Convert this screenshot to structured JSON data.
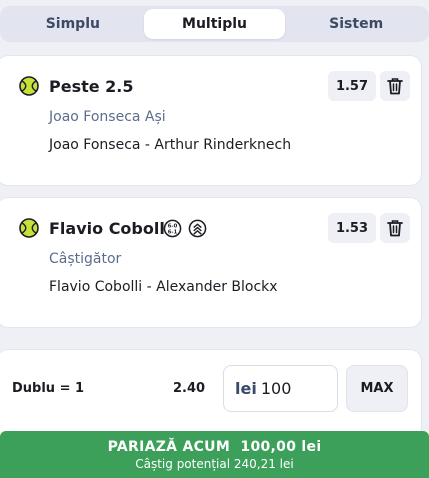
{
  "tabs": {
    "simplu": "Simplu",
    "multiplu": "Multiplu",
    "sistem": "Sistem",
    "active": "multiplu"
  },
  "selections": [
    {
      "title": "Peste 2.5",
      "market": "Joao Fonseca Ași",
      "event": "Joao Fonseca - Arthur Rinderknech",
      "odds": "1.57",
      "icon": "tennis-ball-icon"
    },
    {
      "title": "Flavio Cobolli",
      "market": "Câștigător",
      "event": "Flavio Cobolli - Alexander Blockx",
      "odds": "1.53",
      "icon": "tennis-ball-icon",
      "badges": [
        "live-score-icon",
        "boost-icon"
      ]
    }
  ],
  "bet": {
    "type_label": "Dublu = 1",
    "total_odds": "2.40",
    "currency": "lei",
    "stake": "100",
    "max_label": "MAX",
    "place_label": "PARIAZĂ ACUM  100,00 lei",
    "potential_win": "Câștig potențial 240,21 lei"
  },
  "colors": {
    "primary_green": "#3ca05a",
    "ball": "#c8e03a",
    "market_text": "#5c6c8f"
  }
}
